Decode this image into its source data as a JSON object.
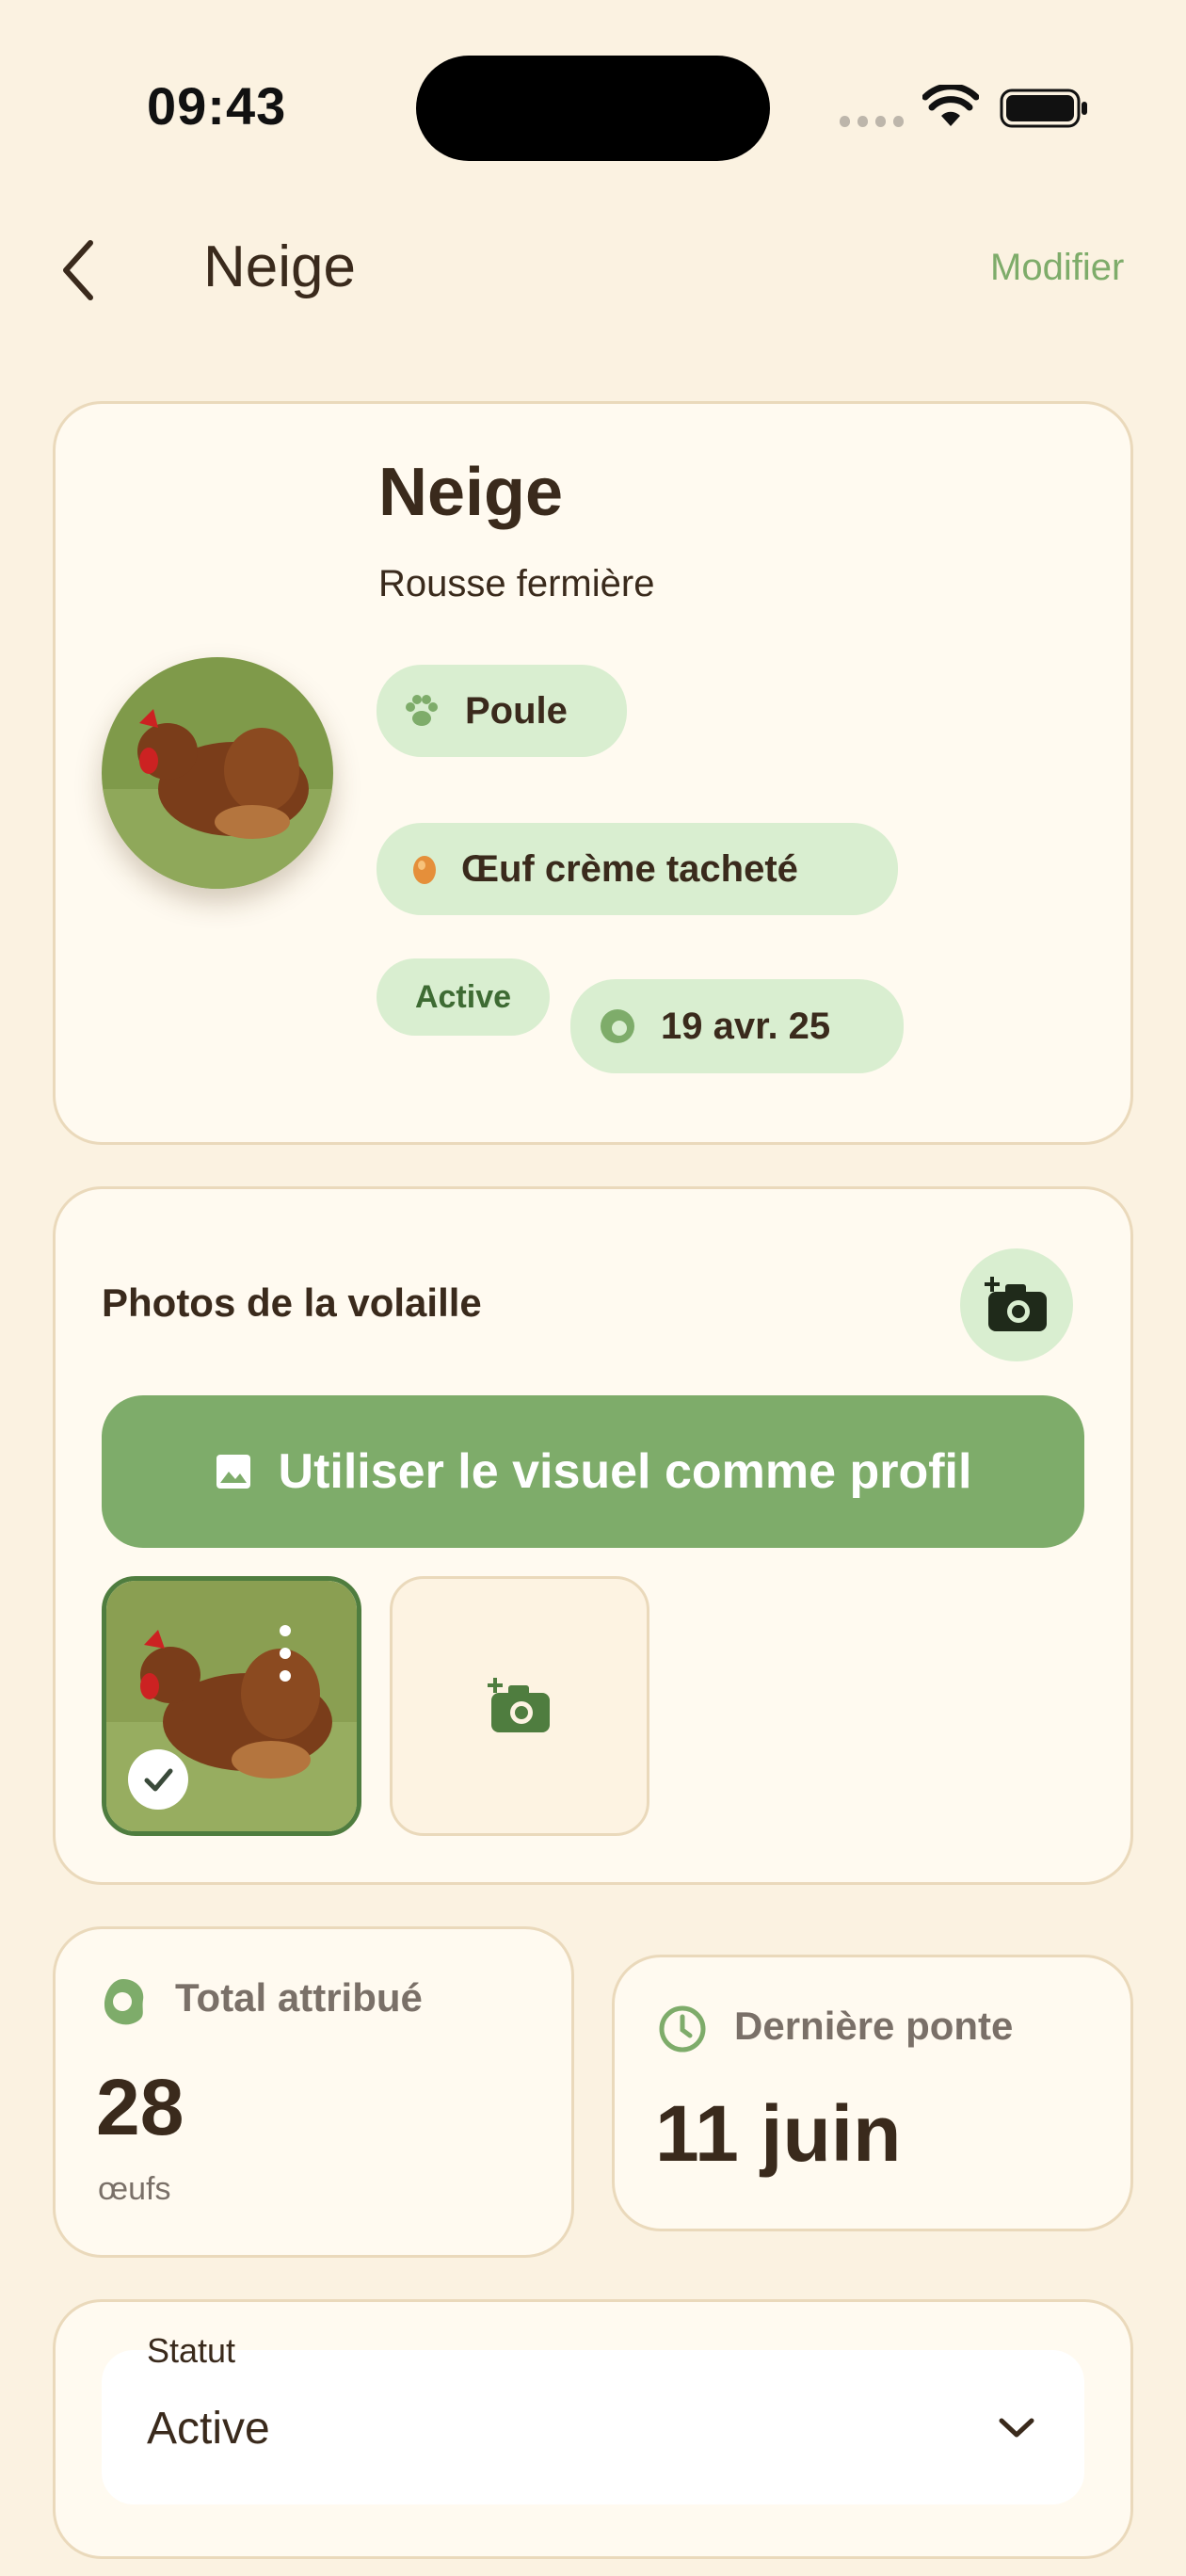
{
  "status_bar": {
    "time": "09:43"
  },
  "nav": {
    "title": "Neige",
    "action": "Modifier"
  },
  "profile": {
    "name": "Neige",
    "breed": "Rousse fermière",
    "species": "Poule",
    "egg": "Œuf crème tacheté",
    "status": "Active",
    "date": "19 avr. 25"
  },
  "photos": {
    "title": "Photos de la volaille",
    "use_as_profile": "Utiliser le visuel comme profil"
  },
  "stats": {
    "total_label": "Total attribué",
    "total_value": "28",
    "total_unit": "œufs",
    "last_label": "Dernière ponte",
    "last_value": "11 juin"
  },
  "status_select": {
    "label": "Statut",
    "value": "Active"
  },
  "colors": {
    "accent": "#7eac6a",
    "pill": "#d9eed0",
    "background": "#fbf2e1",
    "card": "#fffaf0",
    "text": "#3a2a1c"
  }
}
